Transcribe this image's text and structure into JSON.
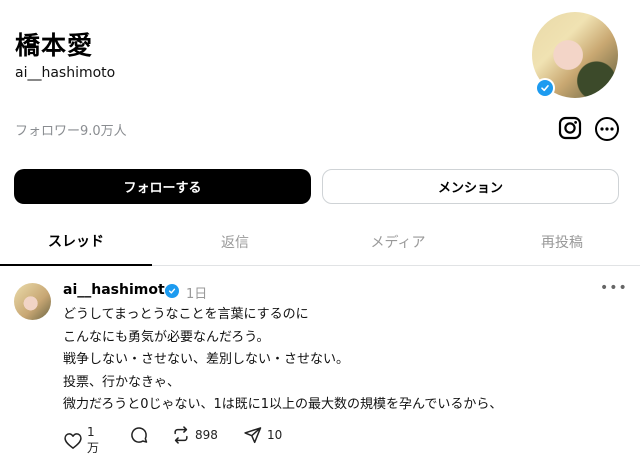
{
  "profile": {
    "name": "橋本愛",
    "handle": "ai__hashimoto",
    "followers": "フォロワー9.0万人"
  },
  "buttons": {
    "follow": "フォローする",
    "mention": "メンション"
  },
  "tabs": [
    {
      "label": "スレッド",
      "active": true
    },
    {
      "label": "返信",
      "active": false
    },
    {
      "label": "メディア",
      "active": false
    },
    {
      "label": "再投稿",
      "active": false
    }
  ],
  "post": {
    "handle": "ai__hashimoto",
    "time": "1日",
    "lines": [
      "どうしてまっとうなことを言葉にするのに",
      "こんなにも勇気が必要なんだろう。",
      "戦争しない・させない、差別しない・させない。",
      "投票、行かなきゃ、",
      "微力だろうと0じゃない、1は既に1以上の最大数の規模を孕んでいるから、"
    ],
    "likes": "1万",
    "reposts": "898",
    "shares": "10"
  },
  "colors": {
    "verified": "#1d9bf0",
    "primary_button": "#000000",
    "muted_text": "#999999"
  },
  "icons": {
    "instagram": "instagram-icon",
    "more": "more-icon",
    "verified": "verified-badge-icon",
    "like": "heart-icon",
    "reply": "comment-icon",
    "repost": "repost-icon",
    "share": "send-icon"
  }
}
